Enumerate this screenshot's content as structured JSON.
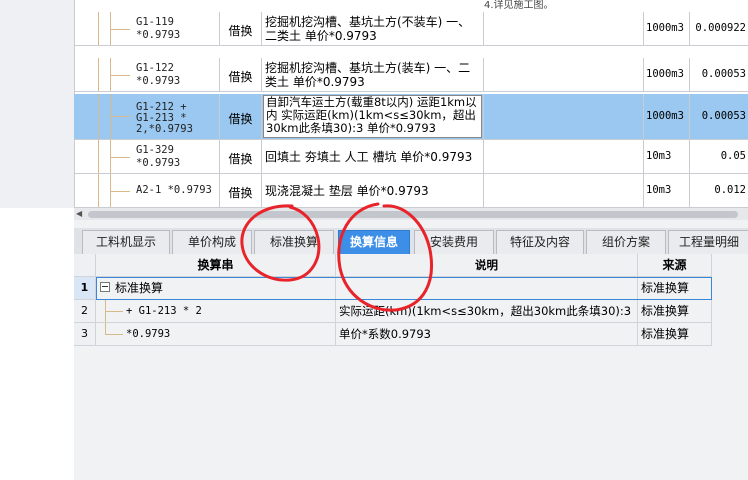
{
  "upper_table": {
    "top_note": "4.详见施工图。",
    "rows": [
      {
        "code": "G1-119\n*0.9793",
        "type": "借换",
        "desc": "挖掘机挖沟槽、基坑土方(不装车) 一、二类土   单价*0.9793",
        "unit": "1000m3",
        "qty": "0.000922",
        "selected": false
      },
      {
        "code": "G1-122\n*0.9793",
        "type": "借换",
        "desc": "挖掘机挖沟槽、基坑土方(装车) 一、二类土   单价*0.9793",
        "unit": "1000m3",
        "qty": "0.00053",
        "selected": false
      },
      {
        "code": "G1-212 +\nG1-213 *\n2,*0.9793",
        "type": "借换",
        "desc": "自卸汽车运土方(载重8t以内) 运距1km以内  实际运距(km)(1km<s≤30km，超出30km此条填30):3   单价*0.9793",
        "unit": "1000m3",
        "qty": "0.00053",
        "selected": true
      },
      {
        "code": "G1-329\n*0.9793",
        "type": "借换",
        "desc": "回填土 夯填土 人工 槽坑  单价*0.9793",
        "unit": "10m3",
        "qty": "0.05",
        "selected": false
      },
      {
        "code": "A2-1 *0.9793",
        "type": "借换",
        "desc": "现浇混凝土 垫层  单价*0.9793",
        "unit": "10m3",
        "qty": "0.012",
        "selected": false
      }
    ]
  },
  "tabs": [
    {
      "label": "工料机显示",
      "active": false
    },
    {
      "label": "单价构成",
      "active": false
    },
    {
      "label": "标准换算",
      "active": false
    },
    {
      "label": "换算信息",
      "active": true
    },
    {
      "label": "安装费用",
      "active": false
    },
    {
      "label": "特征及内容",
      "active": false
    },
    {
      "label": "组价方案",
      "active": false
    },
    {
      "label": "工程量明细",
      "active": false
    }
  ],
  "info_grid": {
    "headers": {
      "expr": "换算串",
      "desc": "说明",
      "source": "来源"
    },
    "rows": [
      {
        "num": "1",
        "expr": "标准换算",
        "desc": "",
        "source": "标准换算"
      },
      {
        "num": "2",
        "expr": "+ G1-213 * 2",
        "desc": "实际运距(km)(1km<s≤30km，超出30km此条填30):3",
        "source": "标准换算"
      },
      {
        "num": "3",
        "expr": "*0.9793",
        "desc": "单价*系数0.9793",
        "source": "标准换算"
      }
    ]
  },
  "colors": {
    "selected_row": "#9ac8f0",
    "active_tab": "#3c8ee6",
    "annotation_red": "#e8242a"
  }
}
